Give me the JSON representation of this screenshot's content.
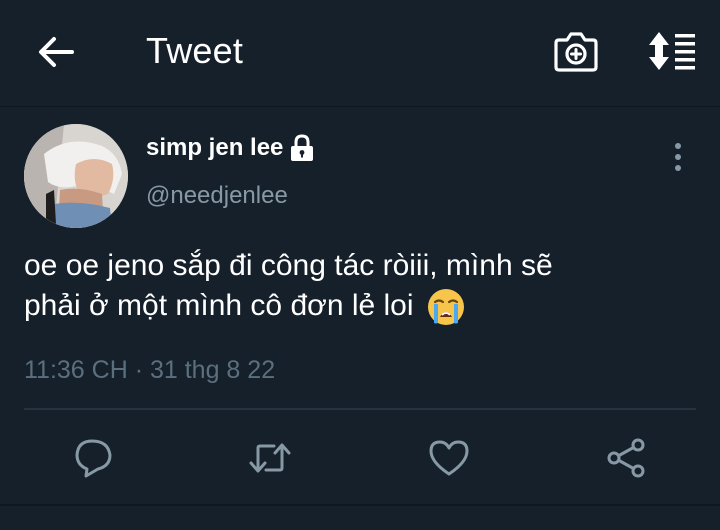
{
  "header": {
    "title": "Tweet",
    "back_icon": "arrow-left-icon",
    "camera_icon": "camera-icon",
    "sort_icon": "sort-icon"
  },
  "tweet": {
    "author": {
      "display_name": "simp jen lee",
      "handle": "@needjenlee",
      "protected": true
    },
    "text_line1": "oe oe jeno sắp đi công tác ròiii, mình sẽ",
    "text_line2": "phải ở một mình cô đơn lẻ loi",
    "emoji": "loudly-crying-face",
    "time": "11:36 CH",
    "separator": " · ",
    "date": "31 thg 8 22"
  },
  "actions": {
    "reply_icon": "reply-icon",
    "retweet_icon": "retweet-icon",
    "like_icon": "heart-icon",
    "share_icon": "share-icon"
  },
  "colors": {
    "background": "#15202b",
    "secondary_text": "#8899a6",
    "timestamp": "#5b6f7e",
    "divider": "#253341"
  }
}
